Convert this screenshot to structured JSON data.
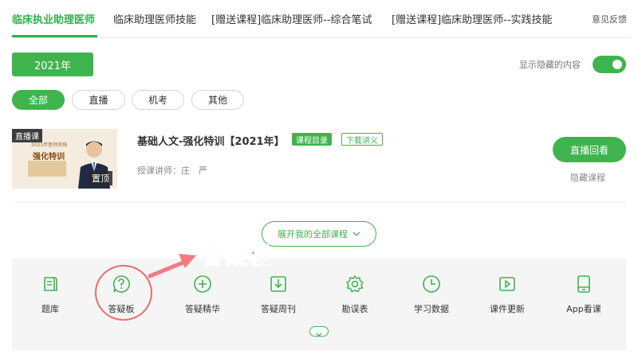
{
  "tabs": [
    {
      "label": "临床执业助理医师",
      "active": true
    },
    {
      "label": "临床助理医师技能",
      "active": false
    },
    {
      "label": "[赠送课程]临床助理医师--综合笔试",
      "active": false
    },
    {
      "label": "[赠送课程]临床助理医师--实践技能",
      "active": false
    }
  ],
  "feedback_label": "意见反馈",
  "year_button": "2021年",
  "toggle": {
    "label": "显示隐藏的内容",
    "on": true
  },
  "filters": [
    {
      "label": "全部",
      "active": true
    },
    {
      "label": "直播",
      "active": false
    },
    {
      "label": "机考",
      "active": false
    },
    {
      "label": "其他",
      "active": false
    }
  ],
  "course": {
    "thumb_badge": "直播课",
    "thumb_line1": "2021年医师资格",
    "thumb_line2": "强化特训",
    "pin_label": "置顶",
    "title": "基础人文-强化特训【2021年】",
    "tag_catalog": "课程目录",
    "tag_download": "下载讲义",
    "teacher": "授课讲师：庄　严",
    "replay_button": "直播回看",
    "hide_label": "隐藏课程"
  },
  "expand_button": "展开我的全部课程",
  "tools": [
    {
      "label": "题库",
      "icon": "question-bank-icon"
    },
    {
      "label": "答疑板",
      "icon": "question-mark-icon"
    },
    {
      "label": "答疑精华",
      "icon": "plus-circle-icon"
    },
    {
      "label": "答疑周刊",
      "icon": "download-box-icon"
    },
    {
      "label": "勘误表",
      "icon": "gear-icon"
    },
    {
      "label": "学习数据",
      "icon": "clock-icon"
    },
    {
      "label": "课件更新",
      "icon": "play-icon"
    },
    {
      "label": "App看课",
      "icon": "tablet-icon"
    }
  ],
  "annotation_text": "答疑板",
  "colors": {
    "accent": "#3fb44e",
    "annotation": "#ff5566"
  }
}
